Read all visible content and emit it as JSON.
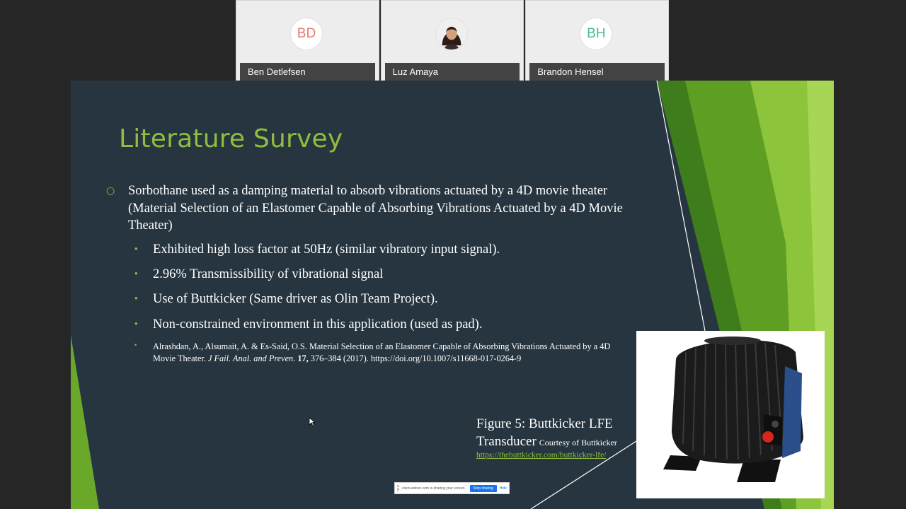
{
  "participants": [
    {
      "initials": "BD",
      "name": "Ben Detlefsen",
      "initials_color": "#e37b6e"
    },
    {
      "initials": "",
      "name": "Luz Amaya",
      "initials_color": "#333333"
    },
    {
      "initials": "BH",
      "name": "Brandon Hensel",
      "initials_color": "#4db897"
    }
  ],
  "slide": {
    "title": "Literature Survey",
    "main_bullet": "Sorbothane used as a damping material to absorb vibrations actuated by a 4D movie theater (Material Selection of an Elastomer Capable of Absorbing Vibrations Actuated by a 4D Movie Theater)",
    "sub_bullets": [
      "Exhibited high loss factor at 50Hz (similar vibratory input signal).",
      "2.96% Transmissibility of vibrational signal",
      "Use of Buttkicker (Same driver as Olin Team Project).",
      "Non-constrained environment in this application (used as pad)."
    ],
    "reference": {
      "authors": "Alrashdan, A., Alsumait, A. & Es-Said, O.S. Material Selection of an Elastomer Capable of Absorbing Vibrations Actuated by a 4D Movie Theater.",
      "journal": "J Fail. Anal. and Preven.",
      "volume": "17,",
      "pages": "376–384 (2017). https://doi.org/10.1007/s11668-017-0264-9"
    },
    "figure_caption": "Figure 5: Buttkicker LFE Transducer",
    "figure_credit": "Courtesy of Buttkicker",
    "figure_link": "https://thebuttkicker.com/buttkicker-lfe/",
    "accent_color": "#8fbe3e"
  },
  "share_bar": {
    "message": "cisco.webex.com is sharing your screen.",
    "stop_label": "Stop sharing",
    "hide_label": "Hide"
  }
}
